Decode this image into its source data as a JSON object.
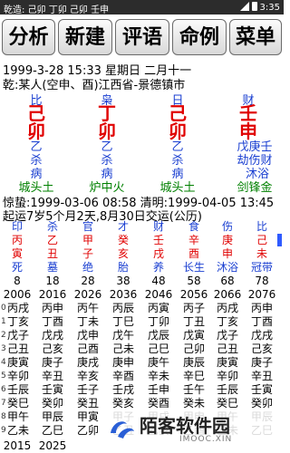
{
  "status_bar": {
    "title": "乾造: 己卯 丁卯 己卯 壬申",
    "time": "3:35"
  },
  "toolbar": {
    "buttons": [
      "分析",
      "新建",
      "评语",
      "命例",
      "菜单"
    ]
  },
  "header": {
    "date_line": "1999-3-28 15:33  星期日  二月十一",
    "person_line": "乾:某人(空申、酉)江西省-景德镇市"
  },
  "pillars": [
    {
      "god": "比",
      "stem": "己",
      "branch": "卯",
      "hidden": [
        "乙"
      ],
      "hidden_gods": [
        "杀"
      ],
      "stage": "病",
      "nayin": "城头土"
    },
    {
      "god": "枭",
      "stem": "丁",
      "branch": "卯",
      "hidden": [
        "乙"
      ],
      "hidden_gods": [
        "杀"
      ],
      "stage": "病",
      "nayin": "炉中火"
    },
    {
      "god": "日",
      "stem": "己",
      "branch": "卯",
      "hidden": [
        "乙"
      ],
      "hidden_gods": [
        "杀"
      ],
      "stage": "病",
      "nayin": "城头土"
    },
    {
      "god": "财",
      "stem": "壬",
      "branch": "申",
      "hidden": [
        "戊",
        "庚",
        "壬"
      ],
      "hidden_gods": [
        "劫",
        "伤",
        "财"
      ],
      "stage": "沐浴",
      "nayin": "剑锋金"
    }
  ],
  "terms": {
    "jingzhe": "惊蛰:1999-03-06 08:58",
    "qingming": "清明:1999-04-05 13:45",
    "qiyun": "起运7岁5个月2天,8月30日交运(公历)"
  },
  "dayun": [
    {
      "god": "印",
      "stem": "丙",
      "branch": "寅",
      "stage": "死",
      "age": "8",
      "year": "2006"
    },
    {
      "god": "杀",
      "stem": "乙",
      "branch": "丑",
      "stage": "墓",
      "age": "18",
      "year": "2016"
    },
    {
      "god": "官",
      "stem": "甲",
      "branch": "子",
      "stage": "绝",
      "age": "28",
      "year": "2026"
    },
    {
      "god": "才",
      "stem": "癸",
      "branch": "亥",
      "stage": "胎",
      "age": "38",
      "year": "2036"
    },
    {
      "god": "财",
      "stem": "壬",
      "branch": "戌",
      "stage": "养",
      "age": "48",
      "year": "2046"
    },
    {
      "god": "食",
      "stem": "辛",
      "branch": "酉",
      "stage": "长生",
      "age": "58",
      "year": "2056"
    },
    {
      "god": "伤",
      "stem": "庚",
      "branch": "申",
      "stage": "沐浴",
      "age": "68",
      "year": "2066"
    },
    {
      "god": "比",
      "stem": "己",
      "branch": "未",
      "stage": "冠带",
      "age": "78",
      "year": "2076"
    }
  ],
  "liunian": {
    "row_index": [
      "0",
      "1",
      "2",
      "3",
      "4",
      "5",
      "6",
      "7",
      "8",
      "9"
    ],
    "columns": [
      [
        "丙戌",
        "丁亥",
        "戊子",
        "己丑",
        "庚寅",
        "辛卯",
        "壬辰",
        "癸巳",
        "甲午",
        "乙未"
      ],
      [
        "丙申",
        "丁酉",
        "戊戌",
        "己亥",
        "庚子",
        "辛丑",
        "壬寅",
        "癸卯",
        "甲辰",
        "乙巳"
      ],
      [
        "丙午",
        "丁未",
        "戊申",
        "己酉",
        "庚戌",
        "辛亥",
        "壬子",
        "癸丑",
        "甲寅",
        "乙卯"
      ],
      [
        "丙辰",
        "丁巳",
        "戊午",
        "己未",
        "庚申",
        "辛酉",
        "壬戌",
        "癸亥",
        "甲子",
        "乙丑"
      ],
      [
        "丙寅",
        "丁卯",
        "戊辰",
        "己巳",
        "庚午",
        "辛未",
        "壬申",
        "癸酉",
        "甲戌",
        "乙亥"
      ],
      [
        "丙子",
        "丁丑",
        "戊寅",
        "己卯",
        "庚辰",
        "辛巳",
        "壬午",
        "癸未",
        "甲申",
        "乙酉"
      ],
      [
        "丙戌",
        "丁亥",
        "戊子",
        "己丑",
        "庚寅",
        "辛卯",
        "壬辰",
        "癸巳",
        "甲午",
        "乙未"
      ],
      [
        "丙申",
        "丁酉",
        "戊戌",
        "己亥",
        "庚子",
        "辛丑",
        "壬寅",
        "癸卯",
        "甲辰",
        "乙巳"
      ]
    ],
    "footer_years": [
      "2015",
      "2025"
    ]
  },
  "watermark": {
    "name": "陌客软件园",
    "sub": "IMOOC.XIN"
  },
  "colors": {
    "red": "#e00000",
    "blue": "#1a3fd1",
    "green": "#008000"
  }
}
